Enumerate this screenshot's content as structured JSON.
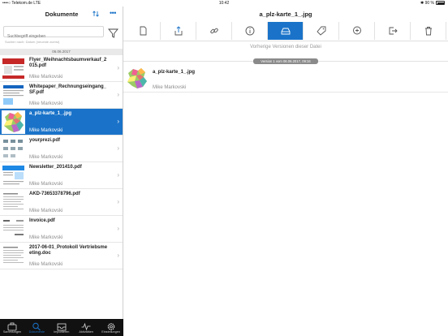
{
  "status": {
    "carrier": "••••○ Telekom.de  LTE",
    "time": "10:42",
    "battery": "✱ 90 %"
  },
  "sidebar": {
    "title": "Dokumente",
    "search_placeholder": "Suchbegriff eingeben",
    "search_hint": "Suchen nach: Datum (neueste zuerst)",
    "date_header": "06.06.2017",
    "documents": [
      {
        "name": "Flyer_Weihnachtsbaumverkauf_2015.pdf",
        "author": "Mike Markovski",
        "thumb": "flyer"
      },
      {
        "name": "Whitepaper_Rechnungseingang_SF.pdf",
        "author": "Mike Markovski",
        "thumb": "whitepaper"
      },
      {
        "name": "a_plz-karte_1_.jpg",
        "author": "Mike Markovski",
        "thumb": "map",
        "selected": true
      },
      {
        "name": "yourprezi.pdf",
        "author": "Mike Markovski",
        "thumb": "prezi"
      },
      {
        "name": "Newsletter_201410.pdf",
        "author": "Mike Markovski",
        "thumb": "newsletter"
      },
      {
        "name": "AKD-73653378796.pdf",
        "author": "Mike Markovski",
        "thumb": "doc"
      },
      {
        "name": "Invoice.pdf",
        "author": "Mike Markovski",
        "thumb": "invoice"
      },
      {
        "name": "2017-06-01_Protokoll Vertriebsmeeting.doc",
        "author": "Mike Markovski",
        "thumb": "doc"
      }
    ]
  },
  "tabs": [
    {
      "label": "Sammlungen",
      "icon": "briefcase-icon"
    },
    {
      "label": "Dokumente",
      "icon": "search-icon",
      "active": true
    },
    {
      "label": "Importieren",
      "icon": "inbox-icon"
    },
    {
      "label": "Aktivitäten",
      "icon": "activity-icon"
    },
    {
      "label": "Einstellungen",
      "icon": "gear-icon"
    }
  ],
  "detail": {
    "title": "a_plz-karte_1_.jpg",
    "toolbar": [
      "document-icon",
      "share-icon",
      "link-icon",
      "info-icon",
      "versions-icon",
      "tag-icon",
      "comment-icon",
      "move-icon",
      "trash-icon"
    ],
    "active_tool": "versions-icon",
    "previous_versions_label": "Vorherige Versionen dieser Datei",
    "version_badge": "Version 1 vom 06.06.2017, 09:34",
    "version": {
      "name": "a_plz-karte_1_.jpg",
      "author": "Mike Markovski"
    }
  },
  "colors": {
    "accent": "#1a73c9",
    "tabbar": "#111111"
  }
}
